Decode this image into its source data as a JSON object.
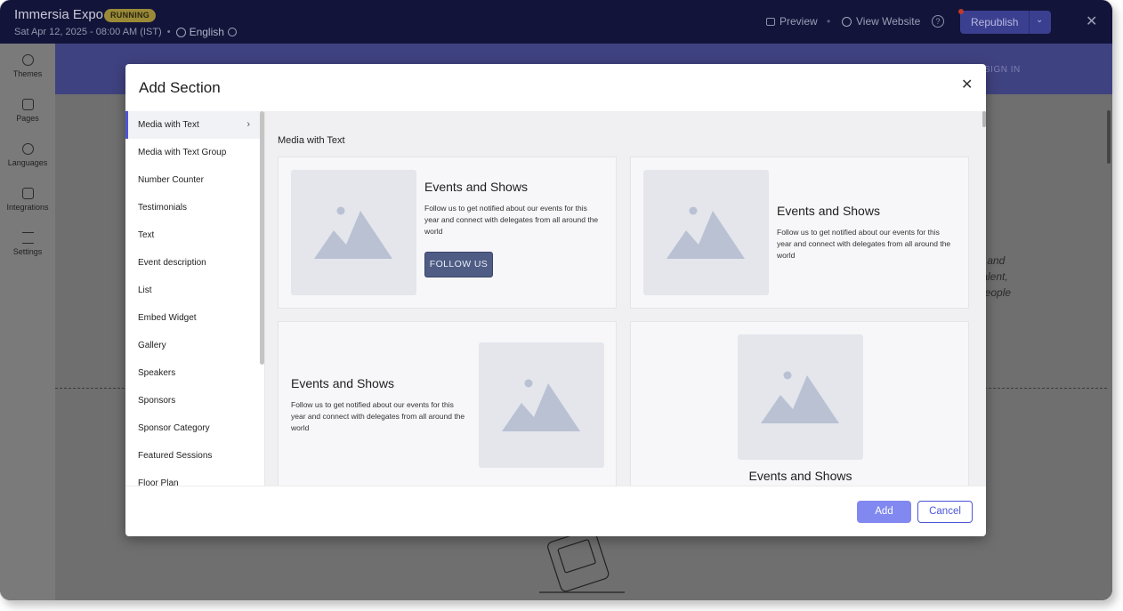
{
  "header": {
    "event_name": "Immersia Expo",
    "status_badge": "RUNNING",
    "datetime": "Sat Apr 12, 2025 - 08:00 AM (IST)",
    "language": "English",
    "preview_label": "Preview",
    "view_website_label": "View Website",
    "help_label": "?",
    "republish_label": "Republish",
    "close_label": "✕"
  },
  "sidebar": {
    "items": [
      {
        "label": "Themes",
        "icon": "palette-icon"
      },
      {
        "label": "Pages",
        "icon": "pages-icon"
      },
      {
        "label": "Languages",
        "icon": "globe-icon"
      },
      {
        "label": "Integrations",
        "icon": "integrations-icon"
      },
      {
        "label": "Settings",
        "icon": "sliders-icon"
      }
    ]
  },
  "background": {
    "nav_text": "SIGN IN",
    "text_lines": [
      "s and",
      "talent,",
      "people"
    ]
  },
  "modal": {
    "title": "Add Section",
    "close_label": "✕",
    "categories": [
      "Media with Text",
      "Media with Text Group",
      "Number Counter",
      "Testimonials",
      "Text",
      "Event description",
      "List",
      "Embed Widget",
      "Gallery",
      "Speakers",
      "Sponsors",
      "Sponsor Category",
      "Featured Sessions",
      "Floor Plan"
    ],
    "active_category": "Media with Text",
    "section_heading": "Media with Text",
    "cards": [
      {
        "title": "Events and Shows",
        "text": "Follow us to get notified about our events for this year and connect with delegates from all around the world",
        "button": "FOLLOW US"
      },
      {
        "title": "Events and Shows",
        "text": "Follow us to get notified about our events for this year and connect with delegates from all around the world"
      },
      {
        "title": "Events and Shows",
        "text": "Follow us to get notified about our events for this year and connect with delegates from all around the world"
      },
      {
        "title": "Events and Shows"
      }
    ],
    "add_label": "Add",
    "cancel_label": "Cancel"
  },
  "colors": {
    "topbar": "#12143a",
    "accent": "#4c55d6",
    "add_button": "#8188f0",
    "follow_button": "#4f5c84",
    "badge": "#9a8a38"
  }
}
